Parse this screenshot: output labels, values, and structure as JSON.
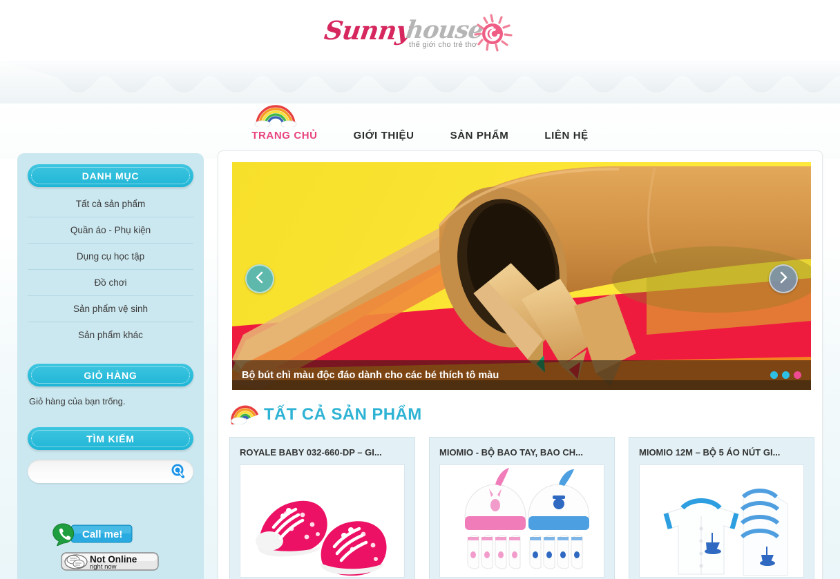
{
  "brand": {
    "name_first": "Sunny",
    "name_second": "house",
    "tagline": "thế giới cho trẻ thơ",
    "sun_icon": "sun-swirl-icon",
    "pink": "#d6285f",
    "gray": "#b5b5b5"
  },
  "nav": {
    "rainbow_icon": "rainbow-icon",
    "items": [
      {
        "label": "TRANG CHỦ",
        "active": true
      },
      {
        "label": "GIỚI THIỆU",
        "active": false
      },
      {
        "label": "SẢN PHẨM",
        "active": false
      },
      {
        "label": "LIÊN HỆ",
        "active": false
      }
    ]
  },
  "sidebar": {
    "categories_heading": "DANH MỤC",
    "categories": [
      {
        "label": "Tất cả sản phẩm"
      },
      {
        "label": "Quần áo - Phụ kiện"
      },
      {
        "label": "Dụng cụ học tập"
      },
      {
        "label": "Đồ chơi"
      },
      {
        "label": "Sản phẩm vệ sinh"
      },
      {
        "label": "Sản phẩm khác"
      }
    ],
    "cart_heading": "GIỎ HÀNG",
    "cart_empty_text": "Giỏ hàng của bạn trống.",
    "search_heading": "TÌM KIẾM",
    "search_value": "",
    "search_placeholder": "",
    "search_icon": "search-magnifier-icon",
    "callme": {
      "label": "Call me!",
      "icon": "phone-handset-icon"
    },
    "status": {
      "line1": "Not Online",
      "line2": "right now",
      "icon": "skype-chat-icon"
    }
  },
  "carousel": {
    "caption": "Bộ bút chì màu độc đáo dành cho các bé thích tô màu",
    "slide_alt": "colored-pencils-in-leather-roll",
    "prev_icon": "chevron-left-icon",
    "next_icon": "chevron-right-icon",
    "dots": [
      {
        "active": false
      },
      {
        "active": false
      },
      {
        "active": true
      }
    ],
    "dot_color": "#2ec0e4",
    "dot_active_color": "#ef4b93"
  },
  "section": {
    "rainbow_icon": "rainbow-icon",
    "title": "TẤT CẢ SẢN PHẨM",
    "title_color": "#2eb3d4"
  },
  "products": [
    {
      "title": "ROYALE BABY 032-660-DP – GI...",
      "image_alt": "pink-polka-dot-baby-sneakers"
    },
    {
      "title": "MIOMIO - BỘ BAO TAY, BAO CH...",
      "image_alt": "baby-hats-and-mittens-set"
    },
    {
      "title": "MIOMIO 12M – BỘ 5 ÁO NÚT GI...",
      "image_alt": "white-baby-shirts-with-blue-trim"
    }
  ]
}
